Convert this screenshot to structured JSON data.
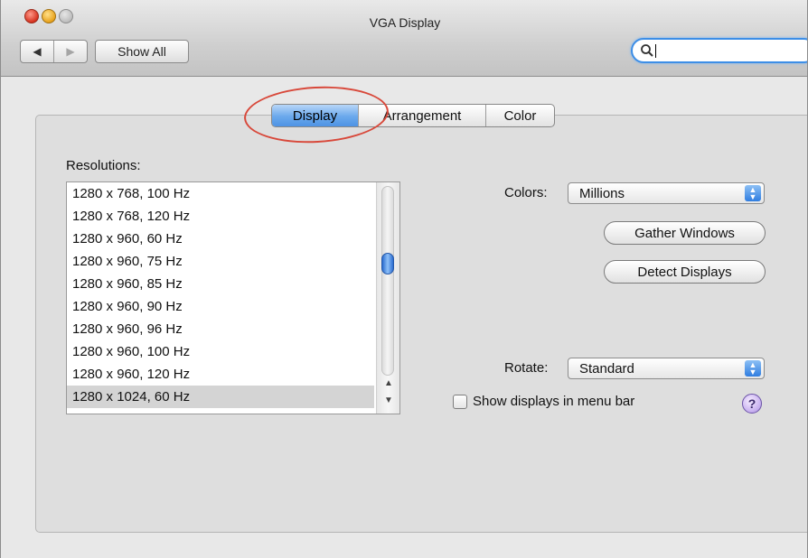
{
  "window": {
    "title": "VGA Display"
  },
  "toolbar": {
    "back_icon": "back-arrow-icon",
    "forward_icon": "forward-arrow-icon",
    "show_all_label": "Show All",
    "search": {
      "value": "",
      "placeholder": ""
    }
  },
  "tabs": [
    {
      "label": "Display",
      "active": true
    },
    {
      "label": "Arrangement",
      "active": false
    },
    {
      "label": "Color",
      "active": false
    }
  ],
  "resolutions": {
    "label": "Resolutions:",
    "items": [
      "1280 x 768, 100 Hz",
      "1280 x 768, 120 Hz",
      "1280 x 960, 60 Hz",
      "1280 x 960, 75 Hz",
      "1280 x 960, 85 Hz",
      "1280 x 960, 90 Hz",
      "1280 x 960, 96 Hz",
      "1280 x 960, 100 Hz",
      "1280 x 960, 120 Hz",
      "1280 x 1024, 60 Hz"
    ],
    "selected": "1280 x 1024, 60 Hz"
  },
  "colors": {
    "label": "Colors:",
    "value": "Millions"
  },
  "buttons": {
    "gather_windows": "Gather Windows",
    "detect_displays": "Detect Displays"
  },
  "rotate": {
    "label": "Rotate:",
    "value": "Standard"
  },
  "menu_bar_checkbox": {
    "label": "Show displays in menu bar",
    "checked": false
  },
  "help": {
    "label": "?"
  },
  "theme": {
    "accent": "#4e93e4",
    "annotation": "#d8483a"
  }
}
